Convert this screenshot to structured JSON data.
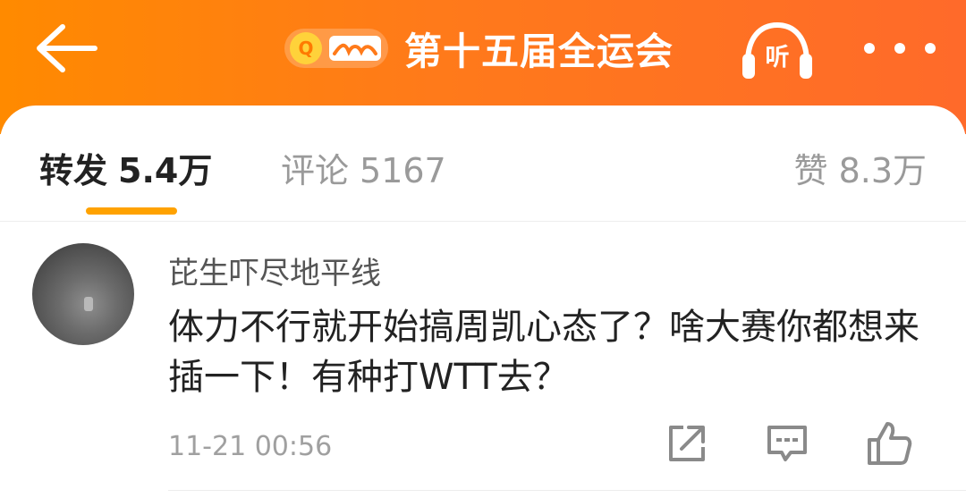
{
  "header": {
    "back_icon": "arrow-left-icon",
    "topic_badge_icon": "search-topic-badge-icon",
    "title": "第十五届全运会",
    "listen_label": "听",
    "listen_icon": "headphones-icon",
    "more_icon": "more-dots-icon",
    "gradient_colors": [
      "#ff8a00",
      "#ff6a2a"
    ]
  },
  "tabs": {
    "repost": {
      "label": "转发",
      "count": "5.4万"
    },
    "comment": {
      "label": "评论",
      "count": "5167"
    },
    "like": {
      "label": "赞",
      "count": "8.3万"
    },
    "active_color": "#ffa200"
  },
  "comment": {
    "username": "芘生吓尽地平线",
    "text": "体力不行就开始搞周凯心态了？啥大赛你都想来插一下！有种打WTT去？",
    "timestamp": "11-21 00:56",
    "actions": [
      "share-icon",
      "reply-icon",
      "like-thumb-icon"
    ]
  }
}
